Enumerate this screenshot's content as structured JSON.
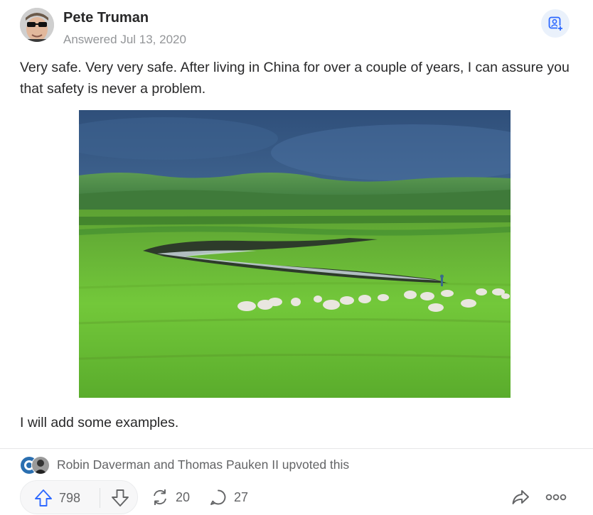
{
  "author": {
    "name": "Pete Truman",
    "answered": "Answered Jul 13, 2020"
  },
  "icons": {
    "follow": "add-user-icon",
    "upvote": "arrow-up-icon",
    "downvote": "arrow-down-icon",
    "reshare": "reshare-icon",
    "comment": "comment-icon",
    "share": "share-arrow-icon",
    "more": "more-dots-icon"
  },
  "answer": {
    "paragraph": "Very safe. Very very safe. After living in China for over a couple of years, I can assure you that safety is never a problem.",
    "footer": "I will add some examples."
  },
  "upvoters": {
    "text": "Robin Daverman and Thomas Pauken II upvoted this"
  },
  "actions": {
    "upvotes": "798",
    "reshares": "20",
    "comments": "27"
  },
  "colors": {
    "accent": "#2e69ff",
    "follow_bg": "#eaf1fb",
    "muted": "#636466"
  }
}
